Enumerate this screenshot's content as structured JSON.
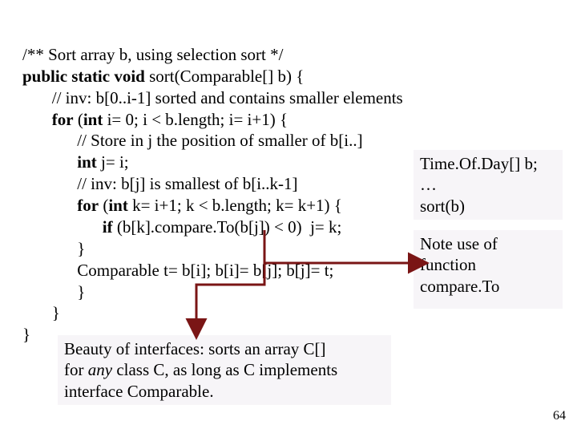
{
  "code": {
    "l1": "/** Sort array b, using selection sort */",
    "l2a": "public static void",
    "l2b": " sort(Comparable[] b) {",
    "l3": "       // inv: b[0..i-1] sorted and contains smaller elements",
    "l4a": "       ",
    "l4b": "for",
    "l4c": " (",
    "l4d": "int",
    "l4e": " i= 0; i < b.length; i= i+1) {",
    "l5": "             // Store in j the position of smaller of b[i..]",
    "l6a": "             ",
    "l6b": "int",
    "l6c": " j= i;",
    "l7": "             // inv: b[j] is smallest of b[i..k-1]",
    "l8a": "             ",
    "l8b": "for",
    "l8c": " (",
    "l8d": "int",
    "l8e": " k= i+1; k < b.length; k= k+1) {",
    "l9a": "                   ",
    "l9b": "if",
    "l9c": " (b[k].compare.To(b[j]) < 0)  j= k;",
    "l10": "             }",
    "l11": "             Comparable t= b[i]; b[i]= b[j]; b[j]= t;",
    "l12": "             }",
    "l13": "       }",
    "l14": "}"
  },
  "side1": {
    "l1": "Time.Of.Day[] b;",
    "l2": "…",
    "l3": "sort(b)"
  },
  "side2": {
    "l1": "Note use of",
    "l2": "function",
    "l3": "compare.To"
  },
  "bottom": {
    "l1": "Beauty of interfaces: sorts an array C[]",
    "l2a": "for ",
    "l2b": "any",
    "l2c": " class C, as long as C implements",
    "l3": "interface Comparable."
  },
  "pagenum": "64"
}
